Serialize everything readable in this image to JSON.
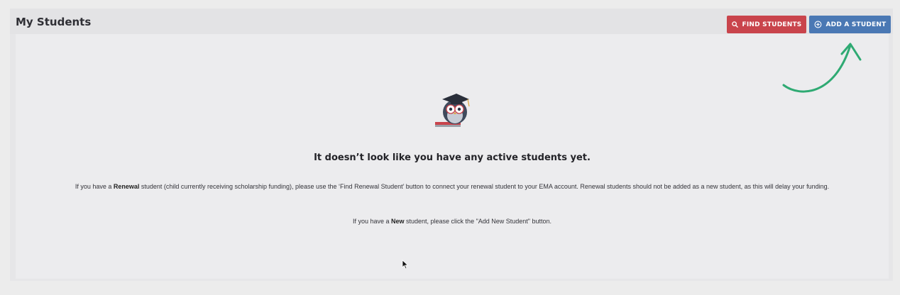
{
  "header": {
    "title": "My Students",
    "find_button_label": "FIND STUDENTS",
    "add_button_label": "ADD A STUDENT"
  },
  "empty_state": {
    "headline": "It doesn’t look like you have any active students yet.",
    "renewal_pre": "If you have a ",
    "renewal_bold": "Renewal",
    "renewal_post": " student (child currently receiving scholarship funding), please use the ‘Find Renewal Student’ button to connect your renewal student to your EMA account. Renewal students should not be added as a new student, as this will delay your funding.",
    "new_pre": "If you have a ",
    "new_bold": "New",
    "new_post": " student, please click the \"Add New Student\" button."
  },
  "colors": {
    "find_button": "#c9444c",
    "add_button": "#4a78b4",
    "annotation_arrow": "#2faa73"
  },
  "icons": {
    "find": "search-icon",
    "add": "plus-circle-icon",
    "mascot": "owl-graduate-mascot"
  }
}
